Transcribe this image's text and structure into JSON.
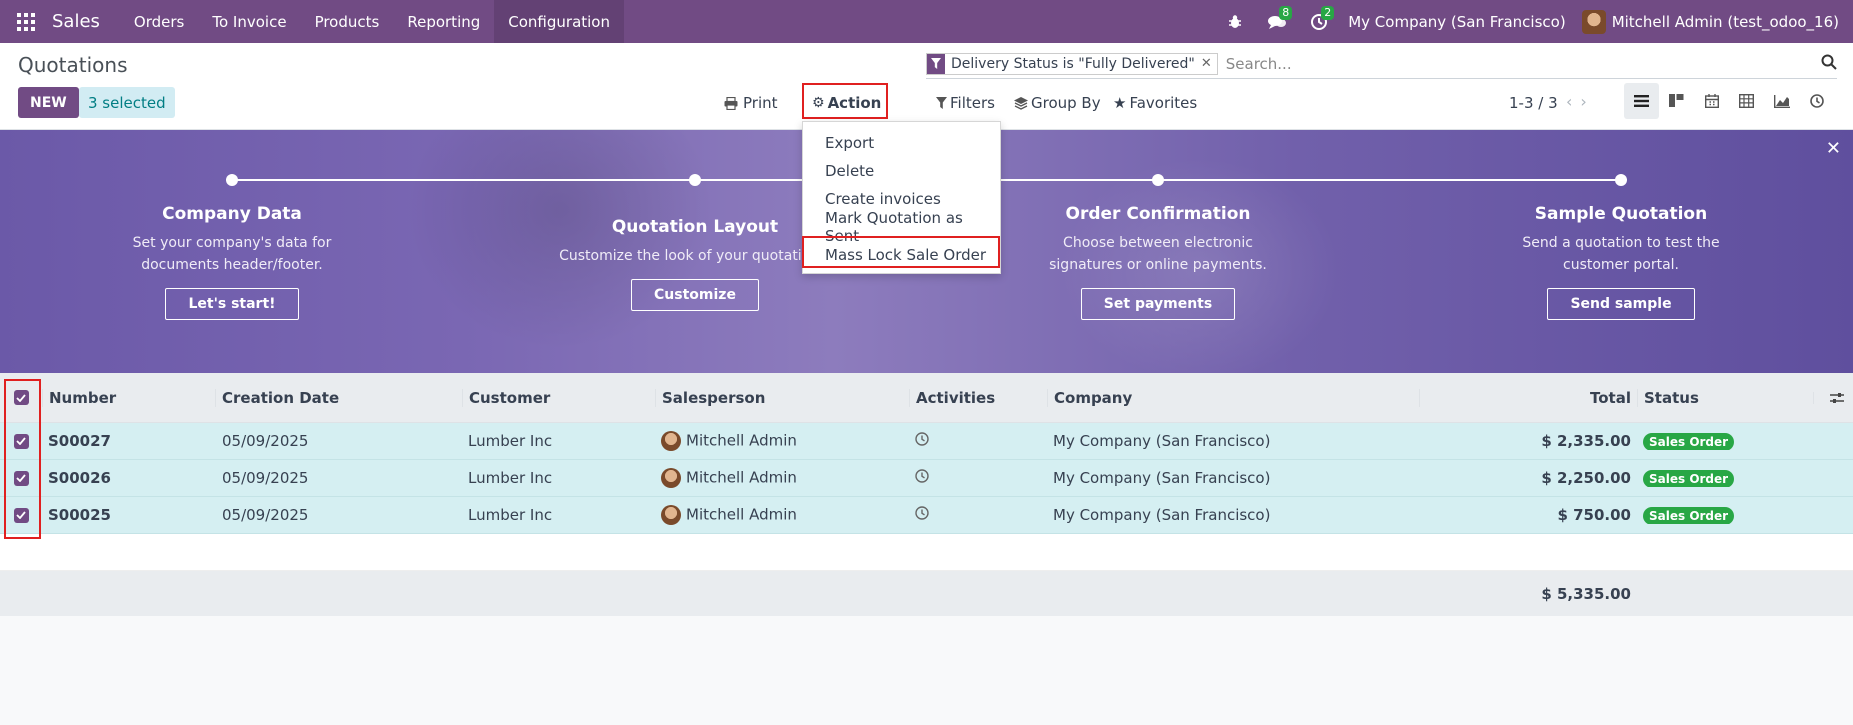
{
  "navbar": {
    "app_name": "Sales",
    "menu": [
      "Orders",
      "To Invoice",
      "Products",
      "Reporting",
      "Configuration"
    ],
    "messages_count": "8",
    "activities_count": "2",
    "company": "My Company (San Francisco)",
    "user": "Mitchell Admin (test_odoo_16)",
    "brand_color": "#714b84"
  },
  "control_panel": {
    "title": "Quotations",
    "new_label": "NEW",
    "selected_label": "3 selected",
    "print_label": "Print",
    "action_label": "Action",
    "filters_label": "Filters",
    "groupby_label": "Group By",
    "favorites_label": "Favorites",
    "facet_text": "Delivery Status is \"Fully Delivered\"",
    "search_placeholder": "Search...",
    "pager": "1-3 / 3"
  },
  "action_menu": {
    "items": [
      "Export",
      "Delete",
      "Create invoices",
      "Mark Quotation as Sent",
      "Mass Lock Sale Order"
    ],
    "highlighted": "Mass Lock Sale Order"
  },
  "banner": {
    "steps": [
      {
        "title": "Company Data",
        "desc": "Set your company's data for documents header/footer.",
        "button": "Let's start!"
      },
      {
        "title": "Quotation Layout",
        "desc": "Customize the look of your quotations.",
        "button": "Customize"
      },
      {
        "title": "Order Confirmation",
        "desc": "Choose between electronic signatures or online payments.",
        "button": "Set payments"
      },
      {
        "title": "Sample Quotation",
        "desc": "Send a quotation to test the customer portal.",
        "button": "Send sample"
      }
    ]
  },
  "table": {
    "headers": {
      "number": "Number",
      "date": "Creation Date",
      "customer": "Customer",
      "salesperson": "Salesperson",
      "activities": "Activities",
      "company": "Company",
      "total": "Total",
      "status": "Status"
    },
    "rows": [
      {
        "number": "S00027",
        "date": "05/09/2025",
        "customer": "Lumber Inc",
        "salesperson": "Mitchell Admin",
        "company": "My Company (San Francisco)",
        "total": "$ 2,335.00",
        "status": "Sales Order"
      },
      {
        "number": "S00026",
        "date": "05/09/2025",
        "customer": "Lumber Inc",
        "salesperson": "Mitchell Admin",
        "company": "My Company (San Francisco)",
        "total": "$ 2,250.00",
        "status": "Sales Order"
      },
      {
        "number": "S00025",
        "date": "05/09/2025",
        "customer": "Lumber Inc",
        "salesperson": "Mitchell Admin",
        "company": "My Company (San Francisco)",
        "total": "$ 750.00",
        "status": "Sales Order"
      }
    ],
    "grand_total": "$ 5,335.00"
  }
}
